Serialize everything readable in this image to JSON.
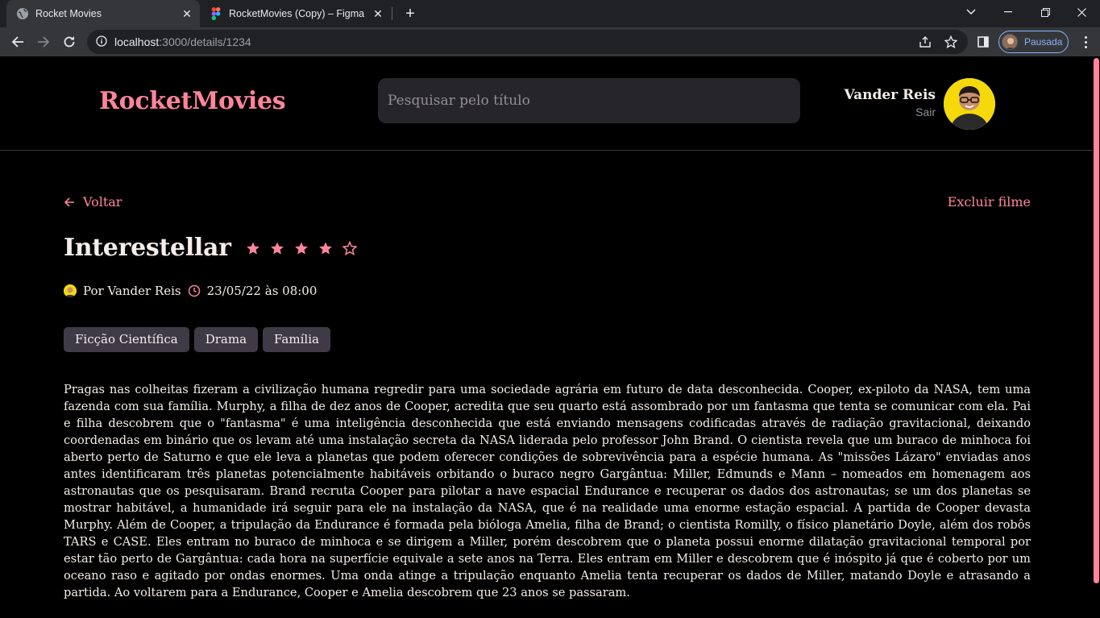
{
  "browser": {
    "tabs": [
      {
        "title": "Rocket Movies",
        "active": true
      },
      {
        "title": "RocketMovies (Copy) – Figma",
        "active": false
      }
    ],
    "url_host": "localhost",
    "url_path": ":3000/details/1234",
    "profile_label": "Pausada"
  },
  "header": {
    "logo": "RocketMovies",
    "search_placeholder": "Pesquisar pelo título",
    "user_name": "Vander Reis",
    "logout_label": "Sair"
  },
  "details": {
    "back_label": "Voltar",
    "delete_label": "Excluir filme",
    "title": "Interestellar",
    "rating": 4,
    "rating_max": 5,
    "author": "Por Vander Reis",
    "datetime": "23/05/22 às 08:00",
    "tags": [
      "Ficção Científica",
      "Drama",
      "Família"
    ],
    "synopsis": "Pragas nas colheitas fizeram a civilização humana regredir para uma sociedade agrária em futuro de data desconhecida. Cooper, ex-piloto da NASA, tem uma fazenda com sua família. Murphy, a filha de dez anos de Cooper, acredita que seu quarto está assombrado por um fantasma que tenta se comunicar com ela. Pai e filha descobrem que o \"fantasma\" é uma inteligência desconhecida que está enviando mensagens codificadas através de radiação gravitacional, deixando coordenadas em binário que os levam até uma instalação secreta da NASA liderada pelo professor John Brand. O cientista revela que um buraco de minhoca foi aberto perto de Saturno e que ele leva a planetas que podem oferecer condições de sobrevivência para a espécie humana. As \"missões Lázaro\" enviadas anos antes identificaram três planetas potencialmente habitáveis orbitando o buraco negro Gargântua: Miller, Edmunds e Mann – nomeados em homenagem aos astronautas que os pesquisaram. Brand recruta Cooper para pilotar a nave espacial Endurance e recuperar os dados dos astronautas; se um dos planetas se mostrar habitável, a humanidade irá seguir para ele na instalação da NASA, que é na realidade uma enorme estação espacial. A partida de Cooper devasta Murphy. Além de Cooper, a tripulação da Endurance é formada pela bióloga Amelia, filha de Brand; o cientista Romilly, o físico planetário Doyle, além dos robôs TARS e CASE. Eles entram no buraco de minhoca e se dirigem a Miller, porém descobrem que o planeta possui enorme dilatação gravitacional temporal por estar tão perto de Gargântua: cada hora na superfície equivale a sete anos na Terra. Eles entram em Miller e descobrem que é inóspito já que é coberto por um oceano raso e agitado por ondas enormes. Uma onda atinge a tripulação enquanto Amelia tenta recuperar os dados de Miller, matando Doyle e atrasando a partida. Ao voltarem para a Endurance, Cooper e Amelia descobrem que 23 anos se passaram."
  },
  "colors": {
    "accent": "#ff859b",
    "background": "#000000",
    "input_bg": "#262529",
    "tag_bg": "#3e3b47",
    "text": "#f4ede8",
    "muted": "#948f99"
  }
}
